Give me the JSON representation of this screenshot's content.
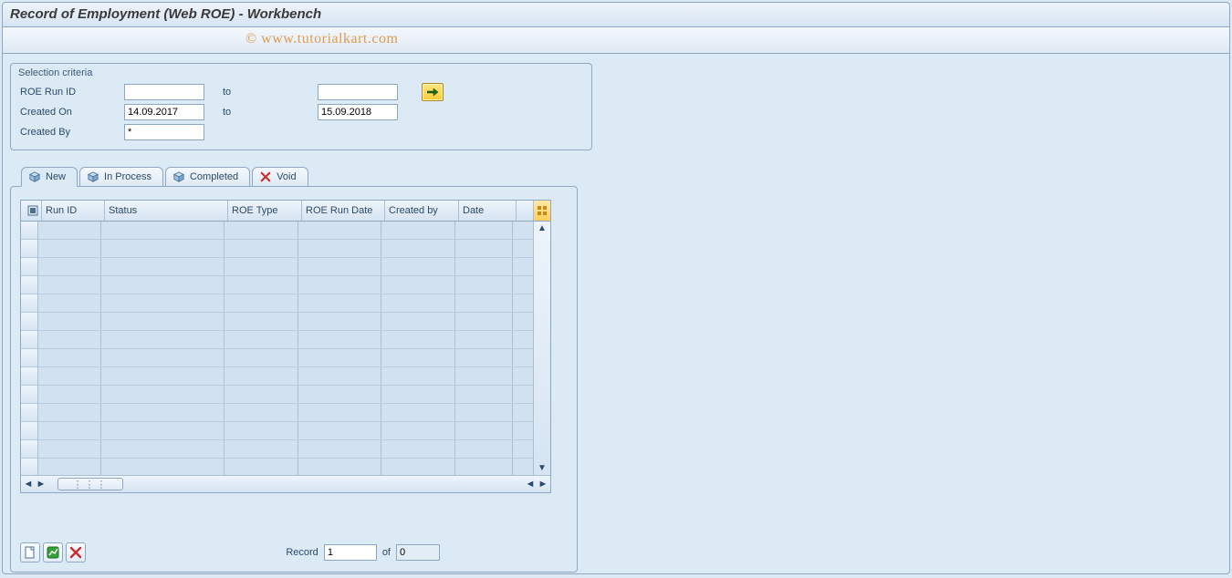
{
  "window": {
    "title": "Record of Employment (Web ROE) - Workbench"
  },
  "watermark": "© www.tutorialkart.com",
  "selection": {
    "title": "Selection criteria",
    "rows": {
      "run_id_label": "ROE Run ID",
      "created_on_label": "Created On",
      "created_by_label": "Created By",
      "to_label": "to",
      "run_id_from": "",
      "run_id_to": "",
      "created_on_from": "14.09.2017",
      "created_on_to": "15.09.2018",
      "created_by": "*"
    }
  },
  "tabs": {
    "new": "New",
    "in_process": "In Process",
    "completed": "Completed",
    "void": "Void"
  },
  "table": {
    "columns": {
      "run_id": "Run ID",
      "status": "Status",
      "roe_type": "ROE Type",
      "roe_run_date": "ROE Run Date",
      "created_by": "Created by",
      "date": "Date"
    },
    "empty_rows": 14
  },
  "footer": {
    "record_label": "Record",
    "record_value": "1",
    "of_label": "of",
    "total_value": "0"
  }
}
